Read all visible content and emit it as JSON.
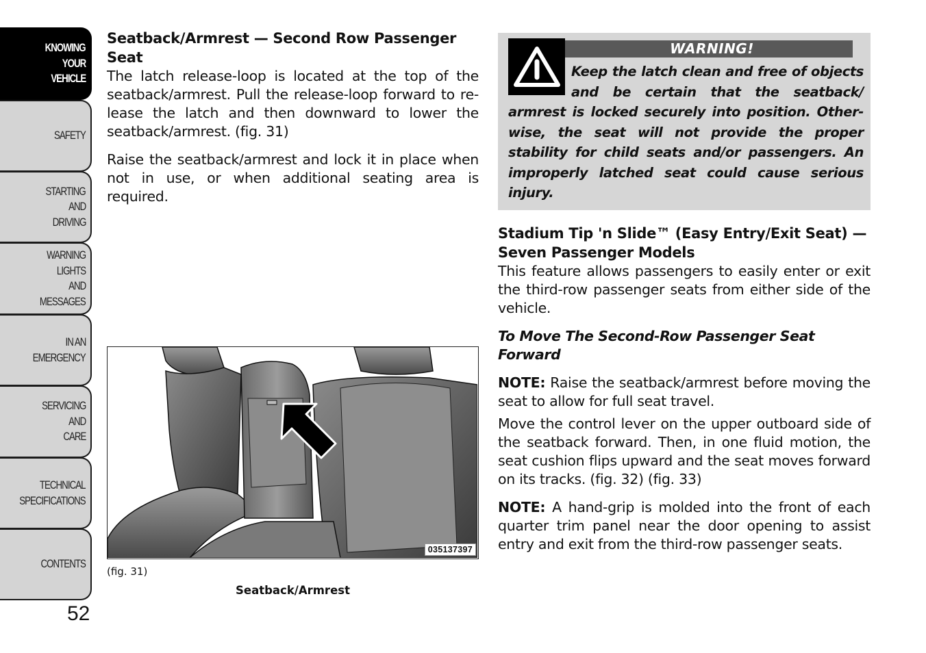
{
  "sidebar": {
    "tabs": [
      {
        "lines": [
          "KNOWING",
          "YOUR",
          "VEHICLE"
        ],
        "active": true
      },
      {
        "lines": [
          "SAFETY"
        ],
        "active": false
      },
      {
        "lines": [
          "STARTING",
          "AND",
          "DRIVING"
        ],
        "active": false
      },
      {
        "lines": [
          "WARNING",
          "LIGHTS",
          "AND",
          "MESSAGES"
        ],
        "active": false
      },
      {
        "lines": [
          "IN AN",
          "EMERGENCY"
        ],
        "active": false
      },
      {
        "lines": [
          "SERVICING",
          "AND",
          "CARE"
        ],
        "active": false
      },
      {
        "lines": [
          "TECHNICAL",
          "SPECIFICATIONS"
        ],
        "active": false
      },
      {
        "lines": [
          "CONTENTS"
        ],
        "active": false
      }
    ]
  },
  "page_number": "52",
  "left_column": {
    "heading": "Seatback/Armrest — Second Row Passenger Seat",
    "paragraph1": "The latch release-loop is located at the top of the seatback/armrest. Pull the release-loop forward to re-lease the latch and then downward to lower the seatback/armrest. (fig.  31)",
    "paragraph2": "Raise the seatback/armrest and lock it in place when not in use, or when additional seating area is required."
  },
  "figure": {
    "code": "035137397",
    "ref": "(fig. 31)",
    "caption": "Seatback/Armrest",
    "icon": "arrow-pointer-icon"
  },
  "warning": {
    "icon": "warning-triangle-icon",
    "title": "WARNING!",
    "text": "Keep the latch clean and free of objects and be certain that the seatback/ armrest is locked securely into position. Other-wise, the seat will not provide the proper stability for child seats and/or passengers. An improperly latched seat could cause serious injury."
  },
  "right_column": {
    "heading": "Stadium Tip 'n Slide™ (Easy Entry/Exit Seat) — Seven Passenger Models",
    "paragraph1": "This feature allows passengers to easily enter or exit the third-row passenger seats from either side of the vehicle.",
    "subheading": "To Move The Second-Row Passenger Seat Forward",
    "note1_label": "NOTE:",
    "note1_text": " Raise the seatback/armrest before moving the seat to allow for full seat travel.",
    "paragraph2": "Move the control lever on the upper outboard side of the seatback forward. Then, in one fluid motion, the seat cushion flips upward and the seat moves forward on its tracks. (fig.  32)  (fig.  33)",
    "note2_label": "NOTE:",
    "note2_text": " A hand-grip is molded into the front of each quarter trim panel near the door opening to assist entry and exit from the third-row passenger seats."
  }
}
